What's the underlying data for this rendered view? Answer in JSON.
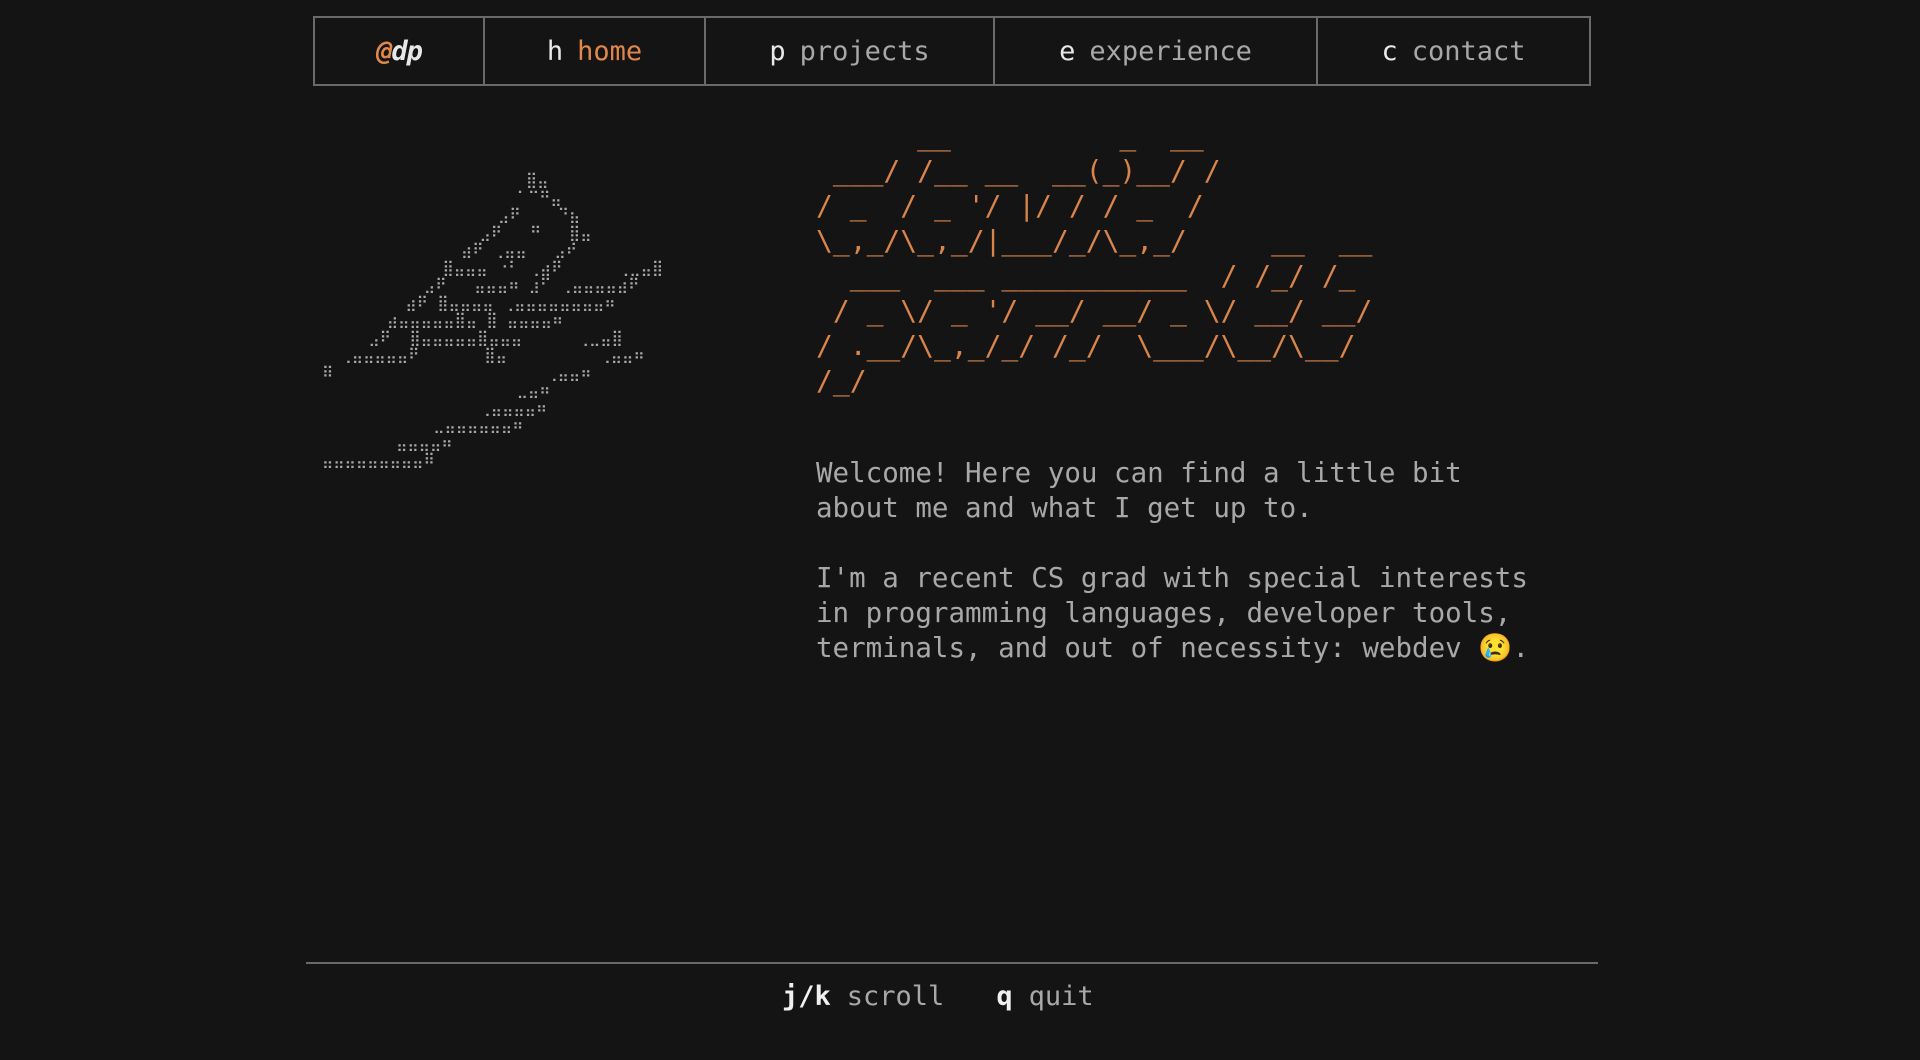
{
  "nav": {
    "brand_at": "@",
    "brand_name": "dp",
    "items": [
      {
        "key": "h",
        "label": "home"
      },
      {
        "key": "p",
        "label": "projects"
      },
      {
        "key": "e",
        "label": "experience"
      },
      {
        "key": "c",
        "label": "contact"
      }
    ],
    "active": "home"
  },
  "hero": {
    "bird_art": "                      ⣿⣤\n                     ⠁⠉⠛⣤\n                   ⣠⠟    ⠙⣦\n                 ⣠⠟   ⠛   ⣿⣤\n               ⣴⠟ ⢀⣤⣤   ⣠⠞\n             ⣿⣤⣤⣤ ⠐⠃ ⢀⣴⠟      ⢀⣀⣤⣿\n           ⣠⠟   ⣤⣤⣤⠶ ⣰⠋ ⢀⣤⣤⣤⣤⣴⠟\n         ⣴⠟ ⣿⣤⣤⣤⣤ ⢀⣤⣤⣤⣤⣤⣤⣤⣤⠶\n       ⣴⣤⣤⣤⣤⣤⣿⣤ ⣿ ⣤⣤⣤⣤⠶\n     ⣠⠟  ⣿⣤⣤⣤⣤⣤⣿⣤⣤⣤      ⢀⣀⣤⣿\n  ⢀⣤⣤⣤⣤⣤⠟       ⣿⣤          ⢀⣤⣤⠶\n⠿                       ⢀⣤⣤⠶\n                     ⣀⣤⠶\n                 ⢀⣤⣤⣤⣤⠶\n            ⣀⣤⣤⣤⣤⣤⣤⠶\n        ⣤⣤⣤⣤⠶\n⣤⣤⣤⣤⣤⣤⣤⣤⣤⠿",
    "name_art": "      __          _  __\n ___/ /__ __  __(_)__/ /\n/ _  / _ '/ |/ / / _  /\n\\_,_/\\_,_/|___/_/\\_,_/     __  __\n  ___  ___ ___________  / /_/ /_\n / _ \\/ _ '/ __/ __/ _ \\/ __/ __/\n/ .__/\\_,_/_/ /_/  \\___/\\__/\\__/\n/_/",
    "paragraph_1": "Welcome! Here you can find a little bit about me and what I get up to.",
    "paragraph_2": "I'm a recent CS grad with special interests in programming languages, developer tools, terminals, and out of necessity: webdev 😢."
  },
  "footer": {
    "scroll_key": "j/k",
    "scroll_label": "scroll",
    "quit_key": "q",
    "quit_label": "quit"
  },
  "colors": {
    "background": "#141414",
    "accent": "#e0884c",
    "text": "#a8a8a8",
    "border": "#6a6a6a"
  }
}
